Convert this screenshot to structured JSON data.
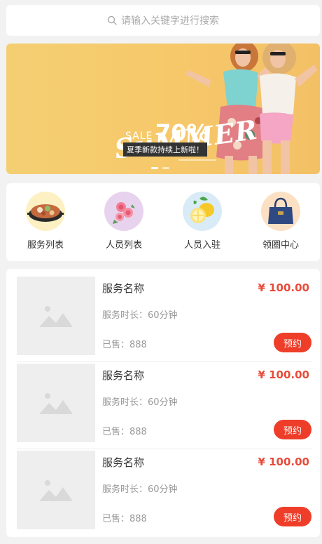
{
  "search": {
    "placeholder": "请输入关键字进行搜索"
  },
  "banner": {
    "headline": "SuMMER",
    "sale": "SALE",
    "percent": "70%",
    "caption": "夏季新款持续上新啦！",
    "slides": 2,
    "active_slide": 0
  },
  "categories": [
    {
      "label": "服务列表",
      "icon": "hotpot-icon",
      "bg": "#fdf0c2"
    },
    {
      "label": "人员列表",
      "icon": "roses-icon",
      "bg": "#e8d3ee"
    },
    {
      "label": "人员入驻",
      "icon": "lemon-icon",
      "bg": "#d8ebf7"
    },
    {
      "label": "领圈中心",
      "icon": "handbag-icon",
      "bg": "#fbe0c4"
    }
  ],
  "products": [
    {
      "name": "服务名称",
      "price": "¥ 100.00",
      "duration": "服务时长：60分钟",
      "sold": "已售：888",
      "button": "预约"
    },
    {
      "name": "服务名称",
      "price": "¥ 100.00",
      "duration": "服务时长：60分钟",
      "sold": "已售：888",
      "button": "预约"
    },
    {
      "name": "服务名称",
      "price": "¥ 100.00",
      "duration": "服务时长：60分钟",
      "sold": "已售：888",
      "button": "预约"
    }
  ],
  "colors": {
    "accent": "#ee3e2a",
    "price": "#e84b3a",
    "banner_bg": "#f4cf72"
  }
}
